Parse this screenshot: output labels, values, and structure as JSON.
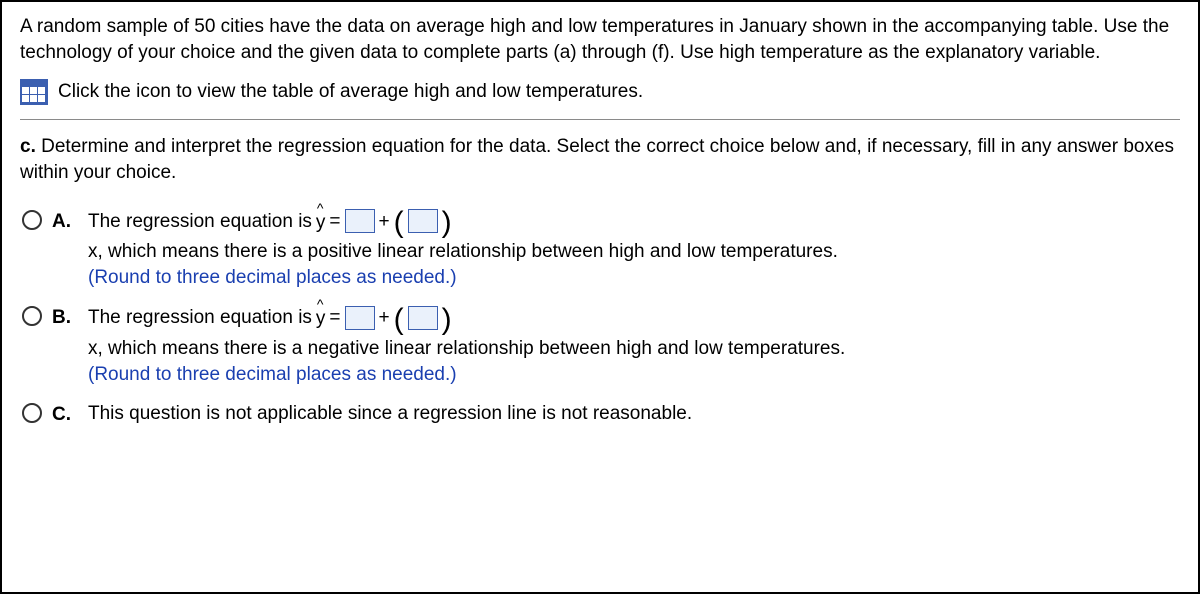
{
  "intro": "A random sample of 50 cities have the data on average high and low temperatures in January shown in the accompanying table. Use the technology of your choice and the given data to complete parts (a) through (f). Use high temperature as the explanatory variable.",
  "link_text": "Click the icon to view the table of average high and low temperatures.",
  "part_label": "c.",
  "part_prompt": "Determine and interpret the regression equation for the data. Select the correct choice below and, if necessary, fill in any answer boxes within your choice.",
  "choices": {
    "a": {
      "letter": "A.",
      "pre": "The regression equation is ",
      "eq1": " = ",
      "plus": " + ",
      "post": " x, which means there is a positive linear relationship between high and low temperatures.",
      "round": "(Round to three decimal places as needed.)"
    },
    "b": {
      "letter": "B.",
      "pre": "The regression equation is ",
      "eq1": " = ",
      "plus": " + ",
      "post": " x, which means there is a negative linear relationship between high and low temperatures.",
      "round": "(Round to three decimal places as needed.)"
    },
    "c": {
      "letter": "C.",
      "text": "This question is not applicable since a regression line is not reasonable."
    }
  },
  "y_symbol": "y"
}
